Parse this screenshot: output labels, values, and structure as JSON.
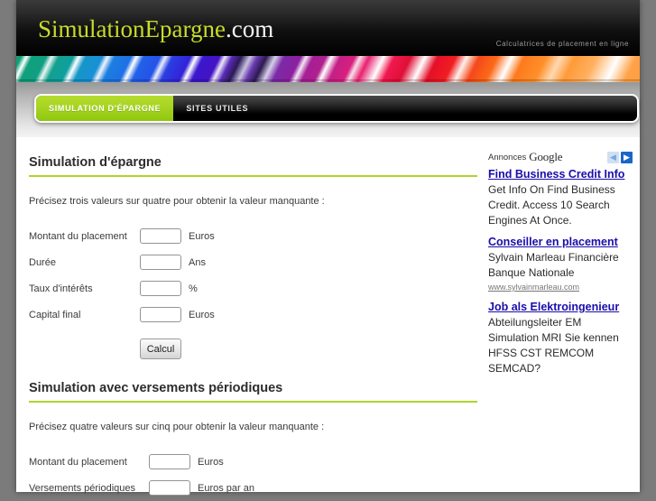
{
  "header": {
    "logo_green": "SimulationEpargne",
    "logo_white": ".com",
    "tagline": "Calculatrices de placement en ligne"
  },
  "nav": {
    "tabs": [
      {
        "label": "SIMULATION D'ÉPARGNE",
        "active": true
      },
      {
        "label": "SITES UTILES",
        "active": false
      }
    ]
  },
  "main": {
    "section1": {
      "title": "Simulation d'épargne",
      "intro": "Précisez trois valeurs sur quatre pour obtenir la valeur manquante :",
      "fields": [
        {
          "label": "Montant du placement",
          "value": "",
          "unit": "Euros"
        },
        {
          "label": "Durée",
          "value": "",
          "unit": "Ans"
        },
        {
          "label": "Taux d'intérêts",
          "value": "",
          "unit": "%"
        },
        {
          "label": "Capital final",
          "value": "",
          "unit": "Euros"
        }
      ],
      "button": "Calcul"
    },
    "section2": {
      "title": "Simulation avec versements périodiques",
      "intro": "Précisez quatre valeurs sur cinq pour obtenir la valeur manquante :",
      "fields": [
        {
          "label": "Montant du placement",
          "value": "",
          "unit": "Euros"
        },
        {
          "label": "Versements périodiques",
          "value": "",
          "unit": "Euros par an"
        }
      ]
    }
  },
  "sidebar": {
    "ads_label": "Annonces",
    "google_wordmark": "Google",
    "prev_arrow": "◀",
    "next_arrow": "▶",
    "ads": [
      {
        "title": "Find Business Credit Info",
        "body": "Get Info On Find Business Credit. Access 10 Search Engines At Once.",
        "url": ""
      },
      {
        "title": "Conseiller en placement",
        "body": "Sylvain Marleau Financière Banque Nationale",
        "url": "www.sylvainmarleau.com"
      },
      {
        "title": "Job als Elektroingenieur",
        "body": "Abteilungsleiter EM Simulation MRI Sie kennen HFSS CST REMCOM SEMCAD?",
        "url": ""
      }
    ]
  },
  "colors": {
    "accent_green": "#aed52a",
    "link_blue": "#1a0dab",
    "header_black": "#000000"
  }
}
